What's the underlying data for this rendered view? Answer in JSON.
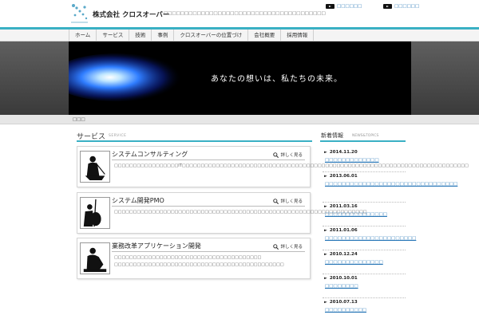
{
  "header": {
    "company": "株式会社 クロスオーバー",
    "tagline": "□□□□□□□□□□□□□□□□□□□□□□□□□□□□□□□□□□□□□□□",
    "logo_text": "CROSS OVER",
    "top_links": [
      {
        "label": "□□□□□□"
      },
      {
        "label": "□□□□□□"
      }
    ]
  },
  "nav": {
    "items": [
      "ホーム",
      "サービス",
      "技術",
      "事例",
      "クロスオーバーの位置づけ",
      "会社概要",
      "採用情報"
    ]
  },
  "hero": {
    "text": "あなたの想いは、私たちの未来。"
  },
  "breadcrumb": {
    "label": "□□□"
  },
  "services": {
    "title": "サービス",
    "subtitle": "SERVICE",
    "more_label": "詳しく見る",
    "cards": [
      {
        "title": "システムコンサルティング",
        "description": "□□□□□□□□□□□□□□□□□IT□□□□□□□□□□□□□□□□□□□□□□□□□□□□□□□□□□□□□□□□□□□□□□□□□□□□□□□□□□□□□□□□□□□□□□□□□□□□"
      },
      {
        "title": "システム開発PMO",
        "description": "□□□□□□□□□□□□□□□□□□□□□□□□□□□□□□□□□□□□□□□□□□□□□□□□□□□□□□□□□□□□□□□□□□□"
      },
      {
        "title": "業務改革アプリケーション開発",
        "description": "□□□□□□□□□□□□□□□□□□□□□□□□□□□□□□□□□□□□□□□ □□□□□□□□□□□□□□□□□□□□□□□□□□□□□□□□□□□□□□□□□□□□□"
      }
    ]
  },
  "news": {
    "title": "新着情報",
    "subtitle": "NEWS&TOPICS",
    "items": [
      {
        "date": "2014.11.20",
        "text": "□□□□□□□□□□□□□"
      },
      {
        "date": "2013.06.01",
        "text": "□□□□□□□□□□□□□□□□□□□□□□□□□□□□□□□□"
      },
      {
        "date": "2011.03.16",
        "text": "□□□□□□□□□□□□□□□"
      },
      {
        "date": "2011.01.06",
        "text": "□□□□□□□□□□□□□□□□□□□□□□"
      },
      {
        "date": "2010.12.24",
        "text": "□□□□□□□□□□□□□□"
      },
      {
        "date": "2010.10.01",
        "text": "□□□□□□□□"
      },
      {
        "date": "2010.07.13",
        "text": "□□□□□□□□□□"
      }
    ]
  },
  "colors": {
    "accent": "#3ab0c4",
    "link": "#2a78b8",
    "hero_bg": "#000000"
  }
}
